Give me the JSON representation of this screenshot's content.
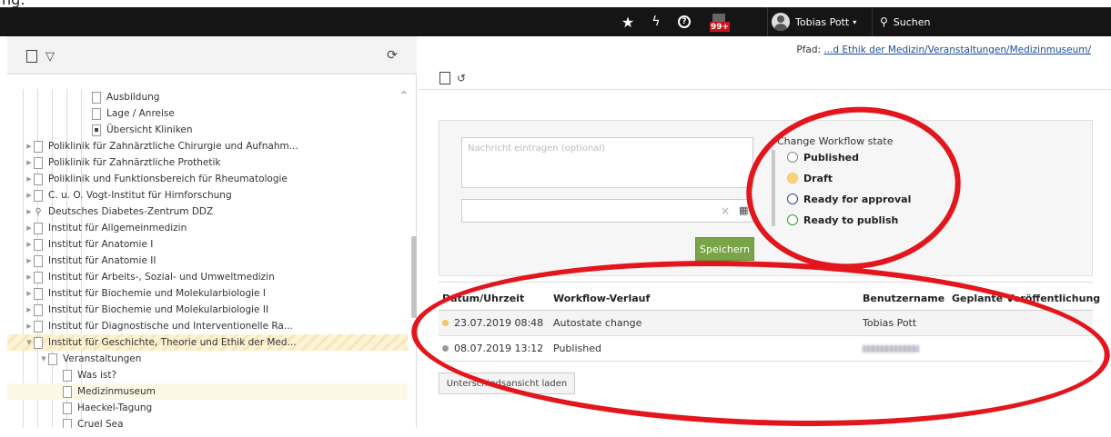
{
  "heading": {
    "text": "ng:"
  },
  "topbar": {
    "bg_color": "#151515",
    "star_icon": "★",
    "bolt_icon": "ϟ",
    "help_icon": "?",
    "notif_badge": "99+",
    "user": {
      "name": "Tobias Pott",
      "caret": "▾"
    },
    "search": {
      "icon": "⚲",
      "label": "Suchen"
    }
  },
  "left": {
    "toolbar": {
      "filter_icon": "▽",
      "refresh_icon": "⟳"
    },
    "scroll_up_icon": "^",
    "tree": [
      {
        "label": "Ausbildung",
        "type": "page",
        "expanded": null
      },
      {
        "label": "Lage / Anreise",
        "type": "page",
        "expanded": null
      },
      {
        "label": "Übersicht Kliniken",
        "type": "overview",
        "expanded": null
      },
      {
        "label": "Poliklinik für Zahnärztliche Chirurgie und Aufnahm...",
        "type": "page",
        "expanded": false
      },
      {
        "label": "Poliklinik für Zahnärztliche Prothetik",
        "type": "page",
        "expanded": false
      },
      {
        "label": "Poliklinik und Funktionsbereich für Rheumatologie",
        "type": "page",
        "expanded": false
      },
      {
        "label": "C. u. O. Vogt-Institut für Hirnforschung",
        "type": "page",
        "expanded": false
      },
      {
        "label": "Deutsches Diabetes-Zentrum DDZ",
        "type": "shortcut",
        "expanded": false
      },
      {
        "label": "Institut für Allgemeinmedizin",
        "type": "page",
        "expanded": false
      },
      {
        "label": "Institut für Anatomie I",
        "type": "page",
        "expanded": false
      },
      {
        "label": "Institut für Anatomie II",
        "type": "page",
        "expanded": false
      },
      {
        "label": "Institut für Arbeits-, Sozial- und Umweltmedizin",
        "type": "page",
        "expanded": false
      },
      {
        "label": "Institut für Biochemie und Molekularbiologie I",
        "type": "page",
        "expanded": false
      },
      {
        "label": "Institut für Biochemie und Molekularbiologie II",
        "type": "page",
        "expanded": false
      },
      {
        "label": "Institut für Diagnostische und Interventionelle Ra...",
        "type": "page",
        "expanded": false
      },
      {
        "label": "Institut für Geschichte, Theorie und Ethik der Med...",
        "type": "page",
        "expanded": true,
        "state": "selected"
      },
      {
        "label": "Veranstaltungen",
        "type": "page",
        "expanded": true
      },
      {
        "label": "Was ist?",
        "type": "page",
        "expanded": null
      },
      {
        "label": "Medizinmuseum",
        "type": "page",
        "expanded": null,
        "state": "active"
      },
      {
        "label": "Haeckel-Tagung",
        "type": "page",
        "expanded": null
      },
      {
        "label": "Cruel Sea",
        "type": "page",
        "expanded": null
      }
    ]
  },
  "right": {
    "path_label": "Pfad:",
    "path_value": "...d Ethik der Medizin/Veranstaltungen/Medizinmuseum/",
    "doc_toolbar": {
      "history_icon": "↺"
    },
    "workflow": {
      "message_placeholder": "Nachricht eintragen (optional)",
      "date_value": "",
      "clear_icon": "×",
      "calendar_icon": "▦",
      "save_label": "Speichern",
      "save_color": "#79a548",
      "state_title": "Change Workflow state",
      "states": [
        {
          "label": "Published",
          "kind": "published"
        },
        {
          "label": "Draft",
          "kind": "draft"
        },
        {
          "label": "Ready for approval",
          "kind": "approval"
        },
        {
          "label": "Ready to publish",
          "kind": "publish"
        }
      ]
    },
    "history": {
      "headers": {
        "date": "Datum/Uhrzeit",
        "flow": "Workflow-Verlauf",
        "user": "Benutzername",
        "planned": "Geplante Veröffentlichung"
      },
      "rows": [
        {
          "date": "23.07.2019 08:48",
          "flow": "Autostate change",
          "user": "Tobias Pott",
          "planned": "",
          "dot_color": "#f7c461"
        },
        {
          "date": "08.07.2019 13:12",
          "flow": "Published",
          "user": "",
          "user_blurred": true,
          "planned": "",
          "dot_color": "#9a9a9a"
        }
      ]
    },
    "diff_button": "Unterschiedsansicht laden"
  },
  "annotation_color": "#e3151d"
}
